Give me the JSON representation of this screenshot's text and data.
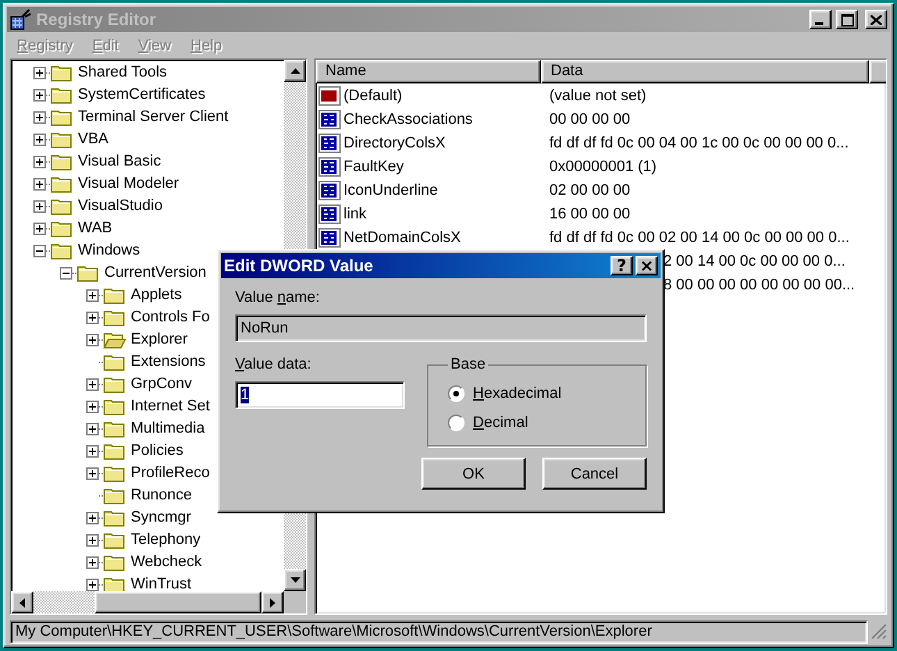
{
  "window": {
    "title": "Registry Editor",
    "active": false
  },
  "menu": [
    {
      "key": "R",
      "post": "egistry"
    },
    {
      "key": "E",
      "post": "dit"
    },
    {
      "key": "V",
      "post": "iew"
    },
    {
      "key": "H",
      "post": "elp"
    }
  ],
  "tree": [
    {
      "label": "Shared Tools",
      "expandable": true,
      "expanded": false,
      "open": false
    },
    {
      "label": "SystemCertificates",
      "expandable": true,
      "expanded": false,
      "open": false
    },
    {
      "label": "Terminal Server Client",
      "expandable": true,
      "expanded": false,
      "open": false
    },
    {
      "label": "VBA",
      "expandable": true,
      "expanded": false,
      "open": false
    },
    {
      "label": "Visual Basic",
      "expandable": true,
      "expanded": false,
      "open": false
    },
    {
      "label": "Visual Modeler",
      "expandable": true,
      "expanded": false,
      "open": false
    },
    {
      "label": "VisualStudio",
      "expandable": true,
      "expanded": false,
      "open": false
    },
    {
      "label": "WAB",
      "expandable": true,
      "expanded": false,
      "open": false
    },
    {
      "label": "Windows",
      "expandable": true,
      "expanded": true,
      "open": false,
      "children": [
        {
          "label": "CurrentVersion",
          "expandable": true,
          "expanded": true,
          "open": false,
          "children": [
            {
              "label": "Applets",
              "expandable": true,
              "expanded": false,
              "open": false
            },
            {
              "label": "Controls Fo",
              "expandable": true,
              "expanded": false,
              "open": false
            },
            {
              "label": "Explorer",
              "expandable": true,
              "expanded": false,
              "open": true
            },
            {
              "label": "Extensions",
              "expandable": false,
              "expanded": false,
              "open": false
            },
            {
              "label": "GrpConv",
              "expandable": true,
              "expanded": false,
              "open": false
            },
            {
              "label": "Internet Set",
              "expandable": true,
              "expanded": false,
              "open": false
            },
            {
              "label": "Multimedia",
              "expandable": true,
              "expanded": false,
              "open": false
            },
            {
              "label": "Policies",
              "expandable": true,
              "expanded": false,
              "open": false
            },
            {
              "label": "ProfileReco",
              "expandable": true,
              "expanded": false,
              "open": false
            },
            {
              "label": "Runonce",
              "expandable": false,
              "expanded": false,
              "open": false
            },
            {
              "label": "Syncmgr",
              "expandable": true,
              "expanded": false,
              "open": false
            },
            {
              "label": "Telephony",
              "expandable": true,
              "expanded": false,
              "open": false
            },
            {
              "label": "Webcheck",
              "expandable": true,
              "expanded": false,
              "open": false
            },
            {
              "label": "WinTrust",
              "expandable": true,
              "expanded": false,
              "open": false
            }
          ]
        }
      ]
    }
  ],
  "values": {
    "columns": [
      "Name",
      "Data"
    ],
    "rows": [
      {
        "kind": "string",
        "name": "(Default)",
        "data": "(value not set)"
      },
      {
        "kind": "binary",
        "name": "CheckAssociations",
        "data": "00 00 00 00"
      },
      {
        "kind": "binary",
        "name": "DirectoryColsX",
        "data": "fd df df fd 0c 00 04 00 1c 00 0c 00 00 00 0..."
      },
      {
        "kind": "binary",
        "name": "FaultKey",
        "data": "0x00000001 (1)"
      },
      {
        "kind": "binary",
        "name": "IconUnderline",
        "data": "02 00 00 00"
      },
      {
        "kind": "binary",
        "name": "link",
        "data": "16 00 00 00"
      },
      {
        "kind": "binary",
        "name": "NetDomainColsX",
        "data": "fd df df fd 0c 00 02 00 14 00 0c 00 00 00 0..."
      },
      {
        "kind": "covered",
        "data": "2 00 14 00 0c 00 00 00 0..."
      },
      {
        "kind": "covered",
        "data": "8 00 00 00 00 00 00 00 00..."
      }
    ]
  },
  "status_bar": "My Computer\\HKEY_CURRENT_USER\\Software\\Microsoft\\Windows\\CurrentVersion\\Explorer",
  "dialog": {
    "title": "Edit DWORD Value",
    "help": "?",
    "close": "×",
    "value_name_label": {
      "pre": "Value ",
      "key": "n",
      "post": "ame:"
    },
    "value_name": "NoRun",
    "value_data_label": {
      "key": "V",
      "post": "alue data:"
    },
    "value_data": "1",
    "base_label": "Base",
    "base_options": [
      {
        "key": "H",
        "post": "exadecimal",
        "selected": true
      },
      {
        "key": "D",
        "post": "ecimal",
        "selected": false
      }
    ],
    "buttons": [
      "OK",
      "Cancel"
    ]
  }
}
